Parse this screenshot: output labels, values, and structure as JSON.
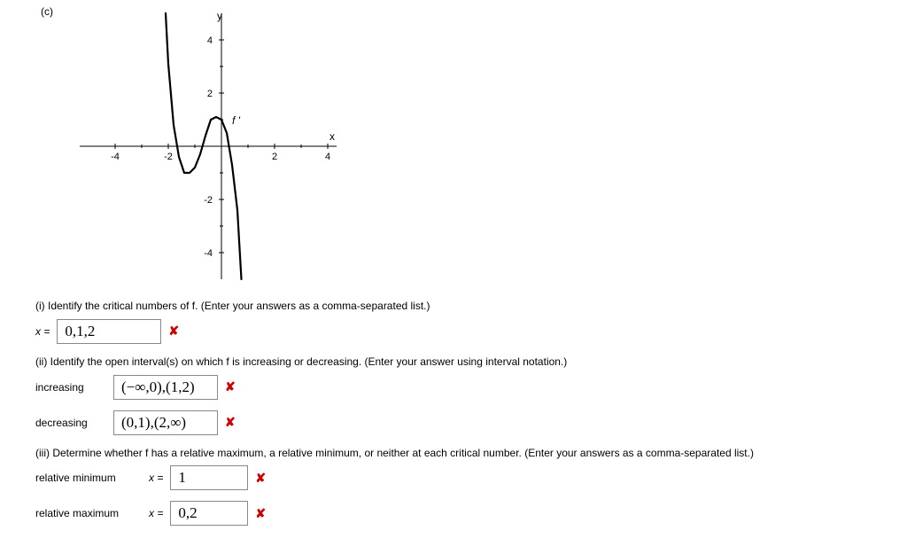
{
  "part_label": "(c)",
  "graph": {
    "y_label": "y",
    "x_label": "x",
    "fprime_label": "f '",
    "x_ticks": [
      "-4",
      "-2",
      "2",
      "4"
    ],
    "y_ticks": [
      "4",
      "2",
      "-2",
      "-4"
    ]
  },
  "q1": {
    "prompt": "(i) Identify the critical numbers of f. (Enter your answers as a comma-separated list.)",
    "var": "x =",
    "answer": "0,1,2",
    "mark": "✘"
  },
  "q2": {
    "prompt": "(ii) Identify the open interval(s) on which f is increasing or decreasing. (Enter your answer using interval notation.)",
    "inc_label": "increasing",
    "inc_answer": "(−∞,0),(1,2)",
    "inc_mark": "✘",
    "dec_label": "decreasing",
    "dec_answer": "(0,1),(2,∞)",
    "dec_mark": "✘"
  },
  "q3": {
    "prompt": "(iii) Determine whether f has a relative maximum, a relative minimum, or neither at each critical number. (Enter your answers as a comma-separated list.)",
    "min_label": "relative minimum",
    "min_var": "x =",
    "min_answer": "1",
    "min_mark": "✘",
    "max_label": "relative maximum",
    "max_var": "x =",
    "max_answer": "0,2",
    "max_mark": "✘"
  },
  "chart_data": {
    "type": "line",
    "title": "",
    "xlabel": "x",
    "ylabel": "y",
    "xlim": [
      -5,
      5
    ],
    "ylim": [
      -5,
      5
    ],
    "series": [
      {
        "name": "f '",
        "x": [
          -2.1,
          -2.0,
          -1.8,
          -1.6,
          -1.4,
          -1.2,
          -1.0,
          -0.8,
          -0.6,
          -0.4,
          -0.2,
          0.0,
          0.2,
          0.4,
          0.6,
          0.75
        ],
        "y": [
          5.0,
          3.1,
          0.8,
          -0.4,
          -1.0,
          -1.0,
          -0.8,
          -0.3,
          0.4,
          1.0,
          1.1,
          1.0,
          0.5,
          -0.7,
          -2.4,
          -5.0
        ]
      }
    ],
    "x_zeros_of_fprime": [
      -1.7,
      -0.7,
      0.25
    ]
  }
}
